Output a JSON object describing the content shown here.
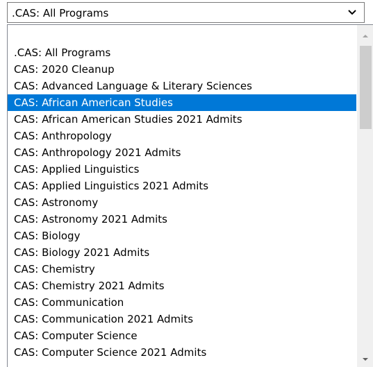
{
  "select": {
    "value": ".CAS: All Programs"
  },
  "icons": {
    "chevron": "chevron-down-icon",
    "scroll_up": "scroll-up-arrow-icon",
    "scroll_down": "scroll-down-arrow-icon"
  },
  "colors": {
    "selection": "#0078d7",
    "scroll_track": "#f0f0f0",
    "scroll_thumb": "#cdcdcd"
  },
  "options": [
    {
      "label": ".CAS: All Programs"
    },
    {
      "label": "CAS: 2020 Cleanup"
    },
    {
      "label": "CAS: Advanced Language & Literary Sciences"
    },
    {
      "label": "CAS: African American Studies"
    },
    {
      "label": "CAS: African American Studies 2021 Admits"
    },
    {
      "label": "CAS: Anthropology"
    },
    {
      "label": "CAS: Anthropology 2021 Admits"
    },
    {
      "label": "CAS: Applied Linguistics"
    },
    {
      "label": "CAS: Applied Linguistics 2021 Admits"
    },
    {
      "label": "CAS: Astronomy"
    },
    {
      "label": "CAS: Astronomy 2021 Admits"
    },
    {
      "label": "CAS: Biology"
    },
    {
      "label": "CAS: Biology 2021 Admits"
    },
    {
      "label": "CAS: Chemistry"
    },
    {
      "label": "CAS: Chemistry 2021 Admits"
    },
    {
      "label": "CAS: Communication"
    },
    {
      "label": "CAS: Communication 2021 Admits"
    },
    {
      "label": "CAS: Computer Science"
    },
    {
      "label": "CAS: Computer Science 2021 Admits"
    }
  ],
  "highlighted_option": "CAS: African American Studies"
}
